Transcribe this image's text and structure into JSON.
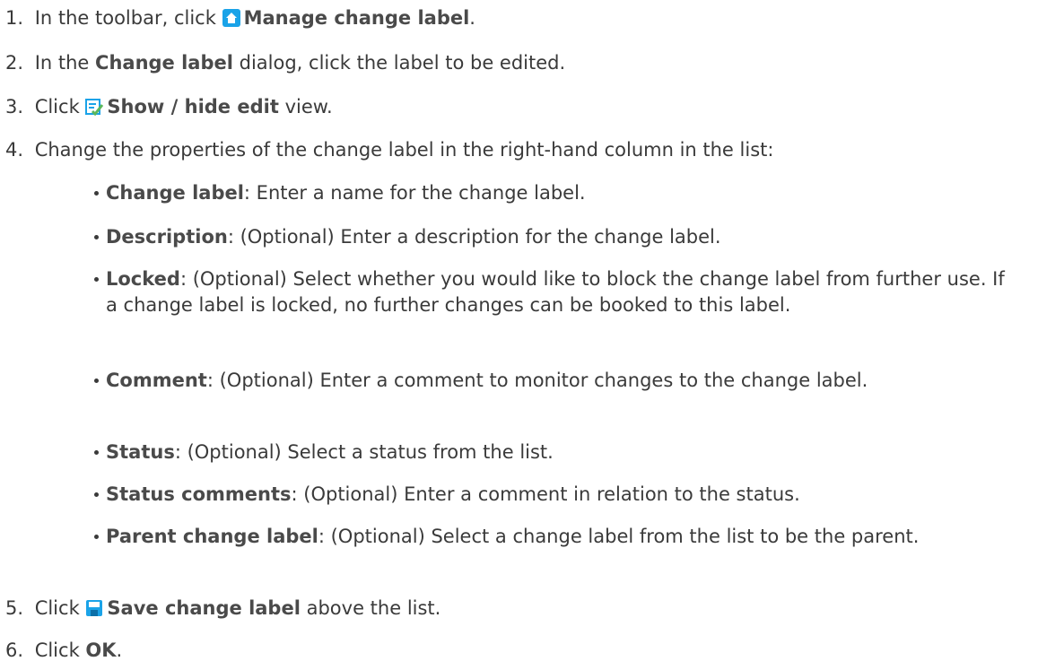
{
  "steps": [
    {
      "num": "1.",
      "before": "In the toolbar, click",
      "bold": "Manage change label",
      "after": ".",
      "icon": "home-icon"
    },
    {
      "num": "2.",
      "before": "In the",
      "bold": "Change label",
      "after": "dialog, click the label to be edited."
    },
    {
      "num": "3.",
      "before": "Click",
      "bold": "Show / hide edit",
      "after": "view.",
      "icon": "edit-view-icon"
    },
    {
      "num": "4.",
      "before": "Change the properties of the change label in the right-hand column in the list:"
    },
    {
      "num": "5.",
      "before": "Click",
      "bold": "Save change label",
      "after": "above the list.",
      "icon": "save-icon"
    },
    {
      "num": "6.",
      "before": "Click",
      "bold": "OK",
      "after": "."
    }
  ],
  "properties": [
    {
      "name": "Change label",
      "text": ": Enter a name for the change label."
    },
    {
      "name": "Description",
      "text": ": (Optional) Enter a description for the change label."
    },
    {
      "name": "Locked",
      "text": ": (Optional) Select whether you would like to block the change label from further use. If a change label is locked, no further changes can be booked to this label."
    },
    {
      "name": "Comment",
      "text": ": (Optional) Enter a comment to monitor changes to the change label."
    },
    {
      "name": "Status",
      "text": ": (Optional) Select a status from the list."
    },
    {
      "name": "Status comments",
      "text": ": (Optional) Enter a comment in relation to the status."
    },
    {
      "name": "Parent change label",
      "text": ": (Optional) Select a change label from the list to be the parent."
    }
  ],
  "colors": {
    "text": "#3a3a3a",
    "icon_accent": "#1aa3e8",
    "icon_green": "#5cb85c"
  }
}
